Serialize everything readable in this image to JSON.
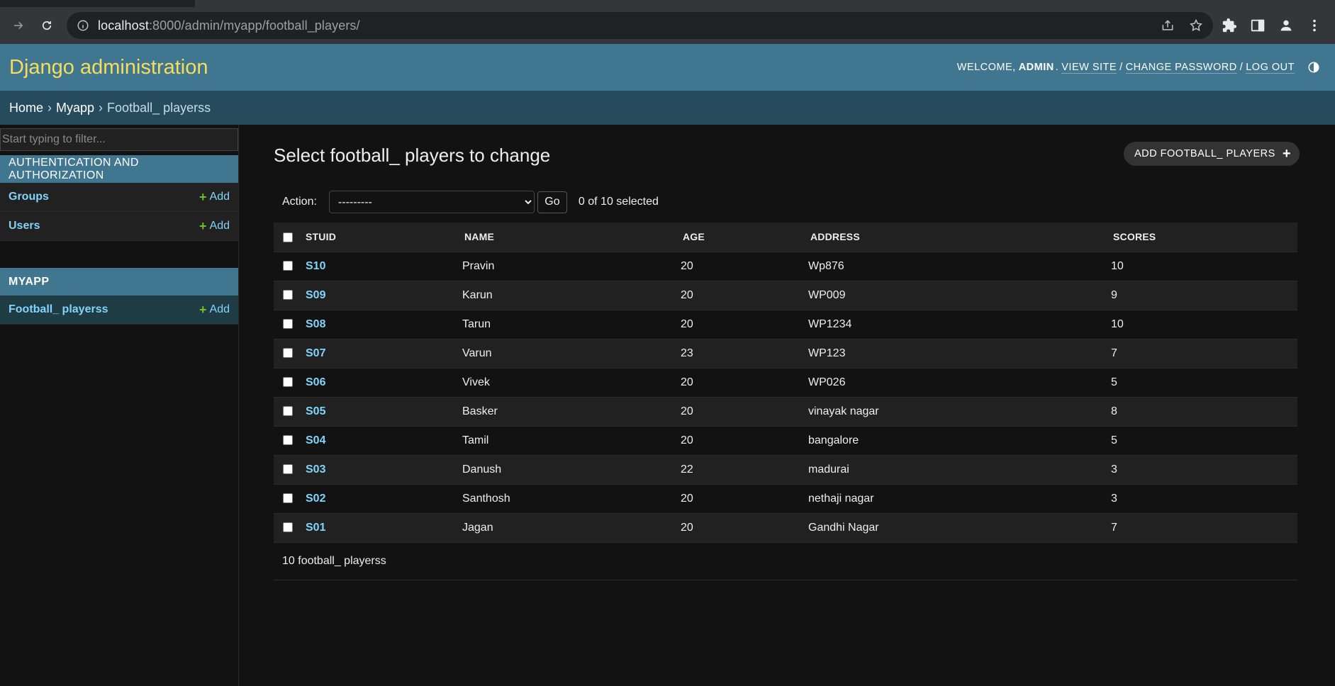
{
  "browser": {
    "url_host": "localhost",
    "url_rest": ":8000/admin/myapp/football_players/"
  },
  "header": {
    "brand": "Django administration",
    "welcome": "Welcome,",
    "username": "admin",
    "view_site": "View site",
    "change_password": "Change password",
    "log_out": "Log out"
  },
  "breadcrumbs": {
    "home": "Home",
    "app": "Myapp",
    "current": "Football_ playerss",
    "sep": "›"
  },
  "sidebar": {
    "filter_placeholder": "Start typing to filter...",
    "auth_caption": "Authentication and Authorization",
    "auth_items": [
      {
        "label": "Groups",
        "add": "Add"
      },
      {
        "label": "Users",
        "add": "Add"
      }
    ],
    "app_caption": "MYAPP",
    "app_items": [
      {
        "label": "Football_ playerss",
        "add": "Add"
      }
    ]
  },
  "content": {
    "title": "Select football_ players to change",
    "add_button": "ADD FOOTBALL_ PLAYERS",
    "action_label": "Action:",
    "action_selected": "---------",
    "go": "Go",
    "selected_count": "0 of 10 selected",
    "columns": [
      "STUID",
      "NAME",
      "AGE",
      "ADDRESS",
      "SCORES"
    ],
    "rows": [
      {
        "stuid": "S10",
        "name": "Pravin",
        "age": "20",
        "address": "Wp876",
        "scores": "10"
      },
      {
        "stuid": "S09",
        "name": "Karun",
        "age": "20",
        "address": "WP009",
        "scores": "9"
      },
      {
        "stuid": "S08",
        "name": "Tarun",
        "age": "20",
        "address": "WP1234",
        "scores": "10"
      },
      {
        "stuid": "S07",
        "name": "Varun",
        "age": "23",
        "address": "WP123",
        "scores": "7"
      },
      {
        "stuid": "S06",
        "name": "Vivek",
        "age": "20",
        "address": "WP026",
        "scores": "5"
      },
      {
        "stuid": "S05",
        "name": "Basker",
        "age": "20",
        "address": "vinayak nagar",
        "scores": "8"
      },
      {
        "stuid": "S04",
        "name": "Tamil",
        "age": "20",
        "address": "bangalore",
        "scores": "5"
      },
      {
        "stuid": "S03",
        "name": "Danush",
        "age": "22",
        "address": "madurai",
        "scores": "3"
      },
      {
        "stuid": "S02",
        "name": "Santhosh",
        "age": "20",
        "address": "nethaji nagar",
        "scores": "3"
      },
      {
        "stuid": "S01",
        "name": "Jagan",
        "age": "20",
        "address": "Gandhi Nagar",
        "scores": "7"
      }
    ],
    "paginator": "10 football_ playerss"
  },
  "colors": {
    "header_bg": "#417690",
    "brand": "#f5dd5d",
    "breadcrumbs_bg": "#264b5d",
    "link": "#81d4fa",
    "add_plus": "#70bf2b",
    "page_bg": "#121212"
  }
}
